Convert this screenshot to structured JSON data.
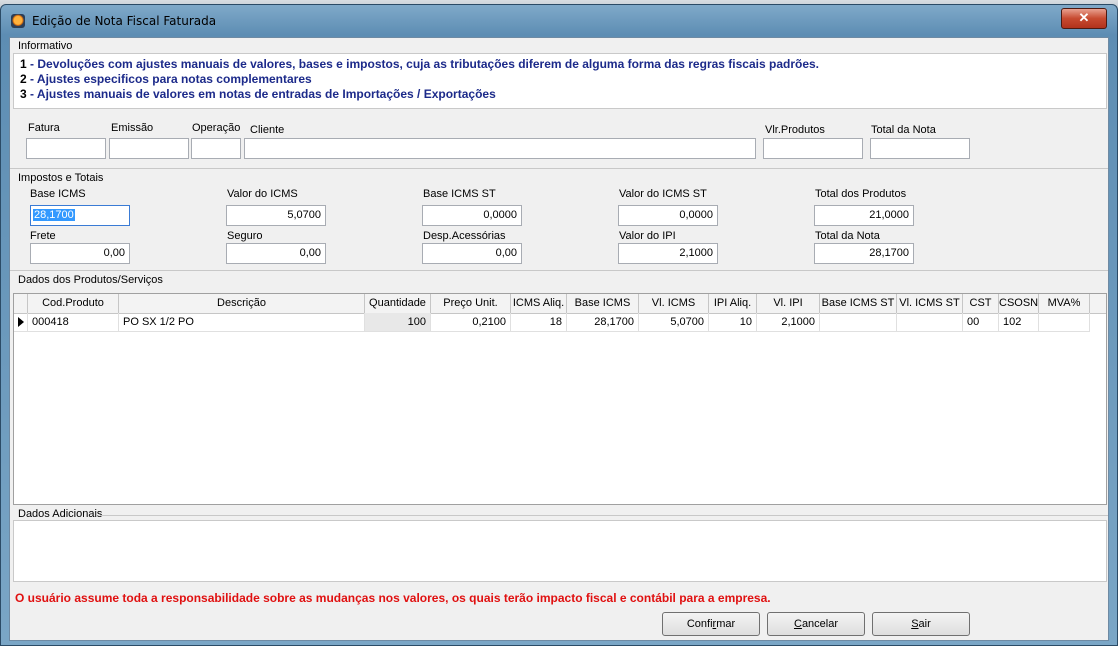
{
  "window": {
    "title": "Edição de Nota Fiscal Faturada",
    "close_glyph": "✕"
  },
  "informativo": {
    "label": "Informativo",
    "lines": [
      {
        "num": "1",
        "text": " - Devoluções com ajustes manuais de valores, bases e impostos, cuja as tributações diferem de alguma forma das regras fiscais padrões."
      },
      {
        "num": "2",
        "text": " - Ajustes especificos para notas complementares"
      },
      {
        "num": "3",
        "text": " - Ajustes manuais de valores em notas de entradas de Importações / Exportações"
      }
    ]
  },
  "header_fields": {
    "fatura": {
      "label": "Fatura",
      "value": ""
    },
    "emissao": {
      "label": "Emissão",
      "value": ""
    },
    "operacao": {
      "label": "Operação",
      "value": ""
    },
    "cliente": {
      "label": "Cliente",
      "value": ""
    },
    "vlr_produtos": {
      "label": "Vlr.Produtos",
      "value": ""
    },
    "total_nota": {
      "label": "Total da Nota",
      "value": ""
    }
  },
  "impostos": {
    "label": "Impostos e Totais",
    "base_icms": {
      "label": "Base ICMS",
      "value": "28,1700"
    },
    "valor_icms": {
      "label": "Valor do ICMS",
      "value": "5,0700"
    },
    "base_icms_st": {
      "label": "Base ICMS ST",
      "value": "0,0000"
    },
    "valor_icms_st": {
      "label": "Valor do ICMS ST",
      "value": "0,0000"
    },
    "total_produtos": {
      "label": "Total dos Produtos",
      "value": "21,0000"
    },
    "frete": {
      "label": "Frete",
      "value": "0,00"
    },
    "seguro": {
      "label": "Seguro",
      "value": "0,00"
    },
    "desp_acessorias": {
      "label": "Desp.Acessórias",
      "value": "0,00"
    },
    "valor_ipi": {
      "label": "Valor do IPI",
      "value": "2,1000"
    },
    "total_nota": {
      "label": "Total da Nota",
      "value": "28,1700"
    }
  },
  "produtos": {
    "label": "Dados dos Produtos/Serviços",
    "columns": [
      "Cod.Produto",
      "Descrição",
      "Quantidade",
      "Preço Unit.",
      "ICMS Aliq.",
      "Base ICMS",
      "Vl. ICMS",
      "IPI Aliq.",
      "Vl. IPI",
      "Base ICMS ST",
      "Vl. ICMS ST",
      "CST",
      "CSOSN",
      "MVA%"
    ],
    "rows": [
      [
        "000418",
        "PO SX 1/2 PO",
        "100",
        "0,2100",
        "18",
        "28,1700",
        "5,0700",
        "10",
        "2,1000",
        "",
        "",
        "00",
        "102",
        ""
      ]
    ]
  },
  "adicionais": {
    "label": "Dados Adicionais",
    "value": ""
  },
  "warning": "O usuário assume toda a responsabilidade sobre as mudanças nos valores, os quais terão impacto fiscal e contábil para a empresa.",
  "buttons": {
    "confirmar": {
      "pre": "Confi",
      "key": "r",
      "post": "mar"
    },
    "cancelar": {
      "pre": "",
      "key": "C",
      "post": "ancelar"
    },
    "sair": {
      "pre": "",
      "key": "S",
      "post": "air"
    }
  }
}
